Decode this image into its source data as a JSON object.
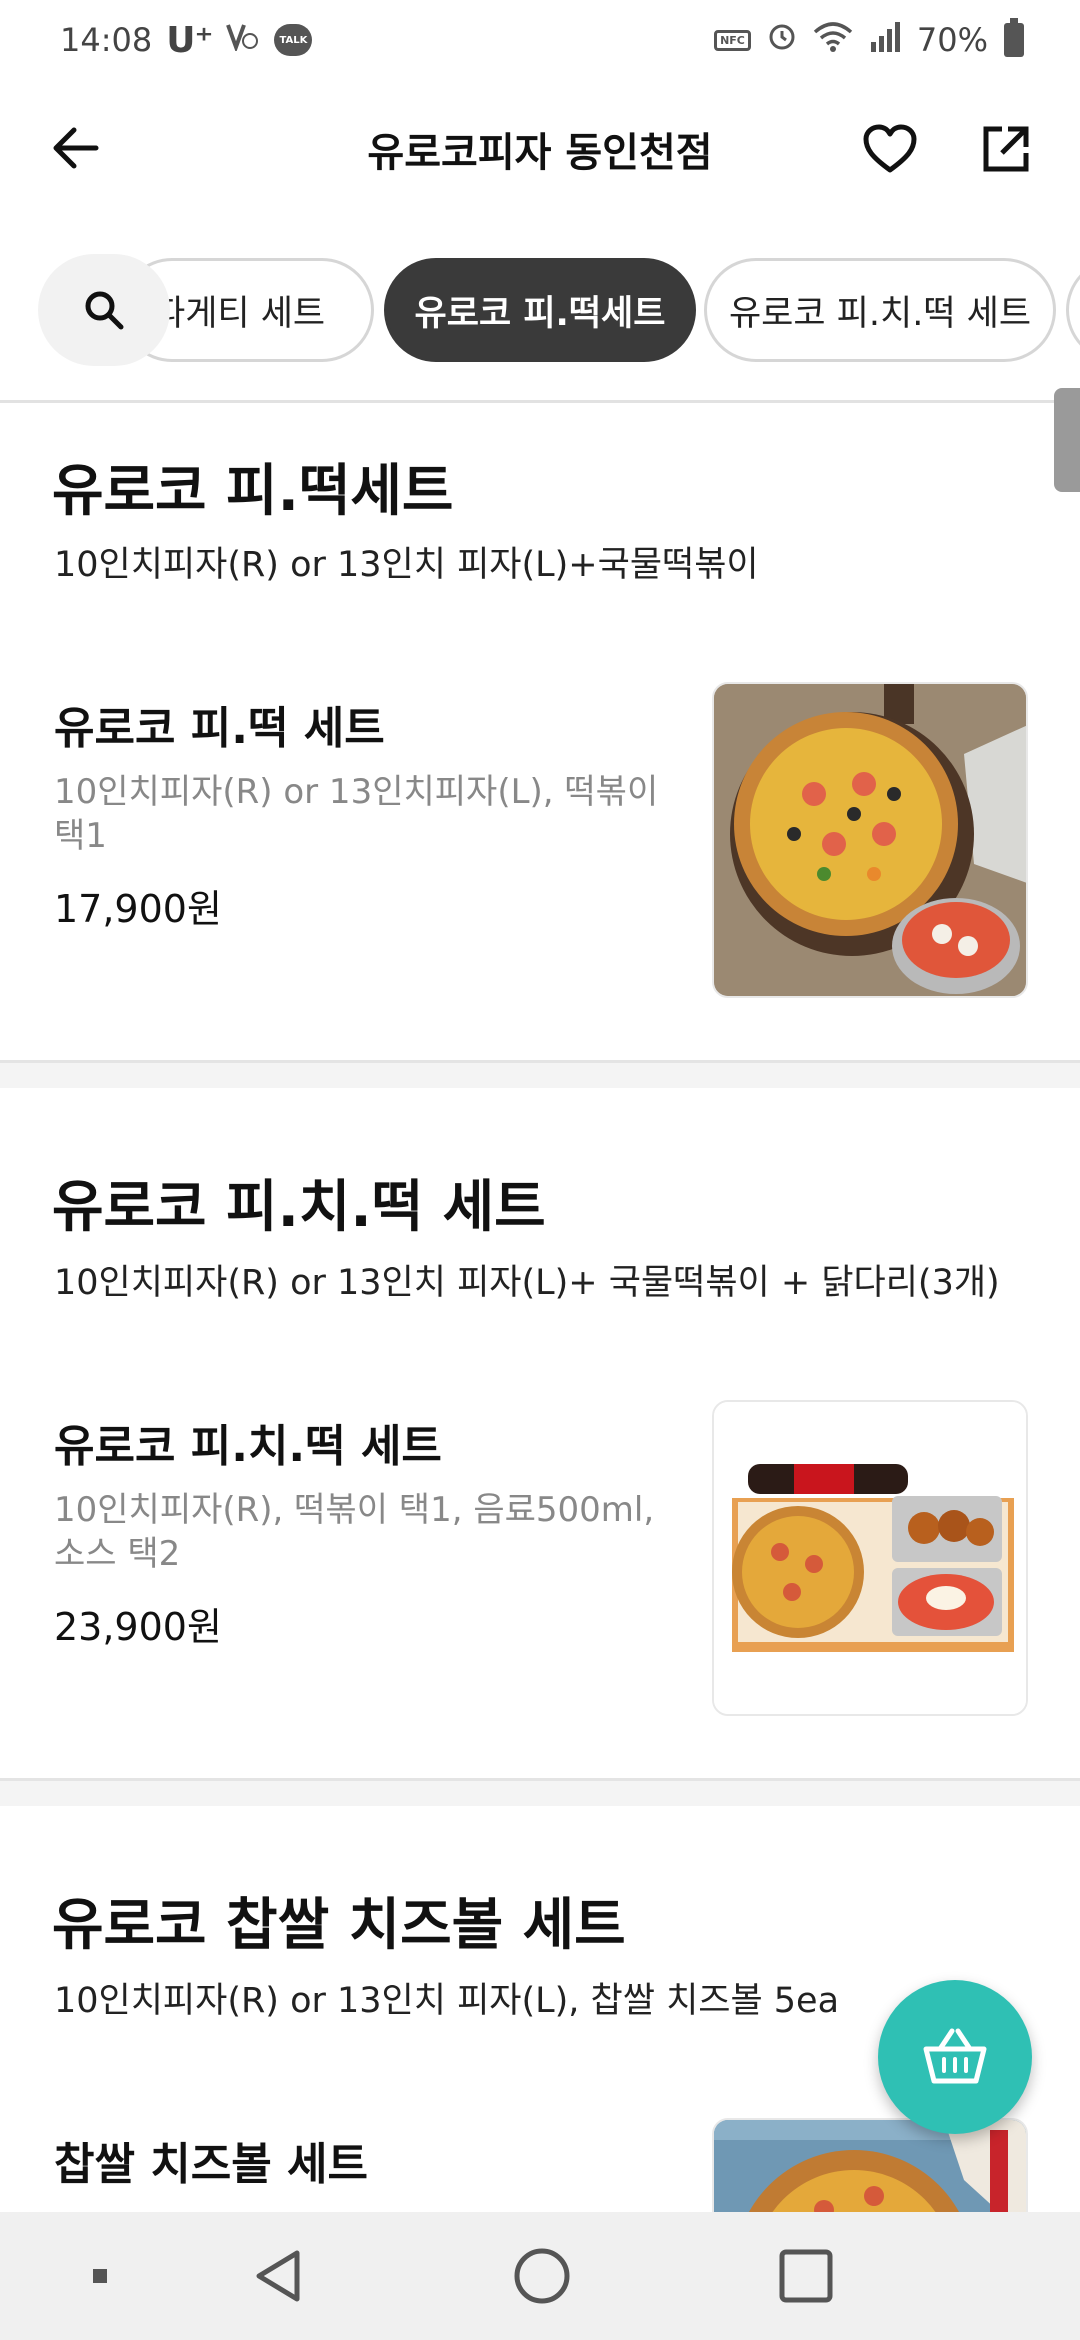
{
  "status_bar": {
    "time": "14:08",
    "carrier": "U⁺",
    "talk_badge": "TALK",
    "nfc": "NFC",
    "battery": "70%"
  },
  "header": {
    "title": "유로코피자 동인천점"
  },
  "tabs": [
    {
      "label": "파게티 세트"
    },
    {
      "label": "유로코 피.떡세트",
      "active": true
    },
    {
      "label": "유로코 피.치.떡 세트"
    }
  ],
  "sections": [
    {
      "title": "유로코 피.떡세트",
      "description": "10인치피자(R) or 13인치 피자(L)+국물떡볶이",
      "items": [
        {
          "name": "유로코 피.떡 세트",
          "desc_line1": "10인치피자(R) or 13인치피자(L), 떡볶이",
          "desc_line2": "택1",
          "price": "17,900원"
        }
      ]
    },
    {
      "title": "유로코 피.치.떡 세트",
      "description": "10인치피자(R) or 13인치 피자(L)+ 국물떡볶이 + 닭다리(3개)",
      "items": [
        {
          "name": "유로코 피.치.떡 세트",
          "desc_line1": "10인치피자(R), 떡볶이 택1, 음료500ml,",
          "desc_line2": "소스 택2",
          "price": "23,900원"
        }
      ]
    },
    {
      "title": "유로코 찹쌀 치즈볼 세트",
      "description": "10인치피자(R) or 13인치 피자(L), 찹쌀 치즈볼 5ea",
      "items": [
        {
          "name": "찹쌀 치즈볼 세트"
        }
      ]
    }
  ],
  "colors": {
    "accent": "#2fc0b4",
    "active_tab": "#3a3a3a"
  }
}
